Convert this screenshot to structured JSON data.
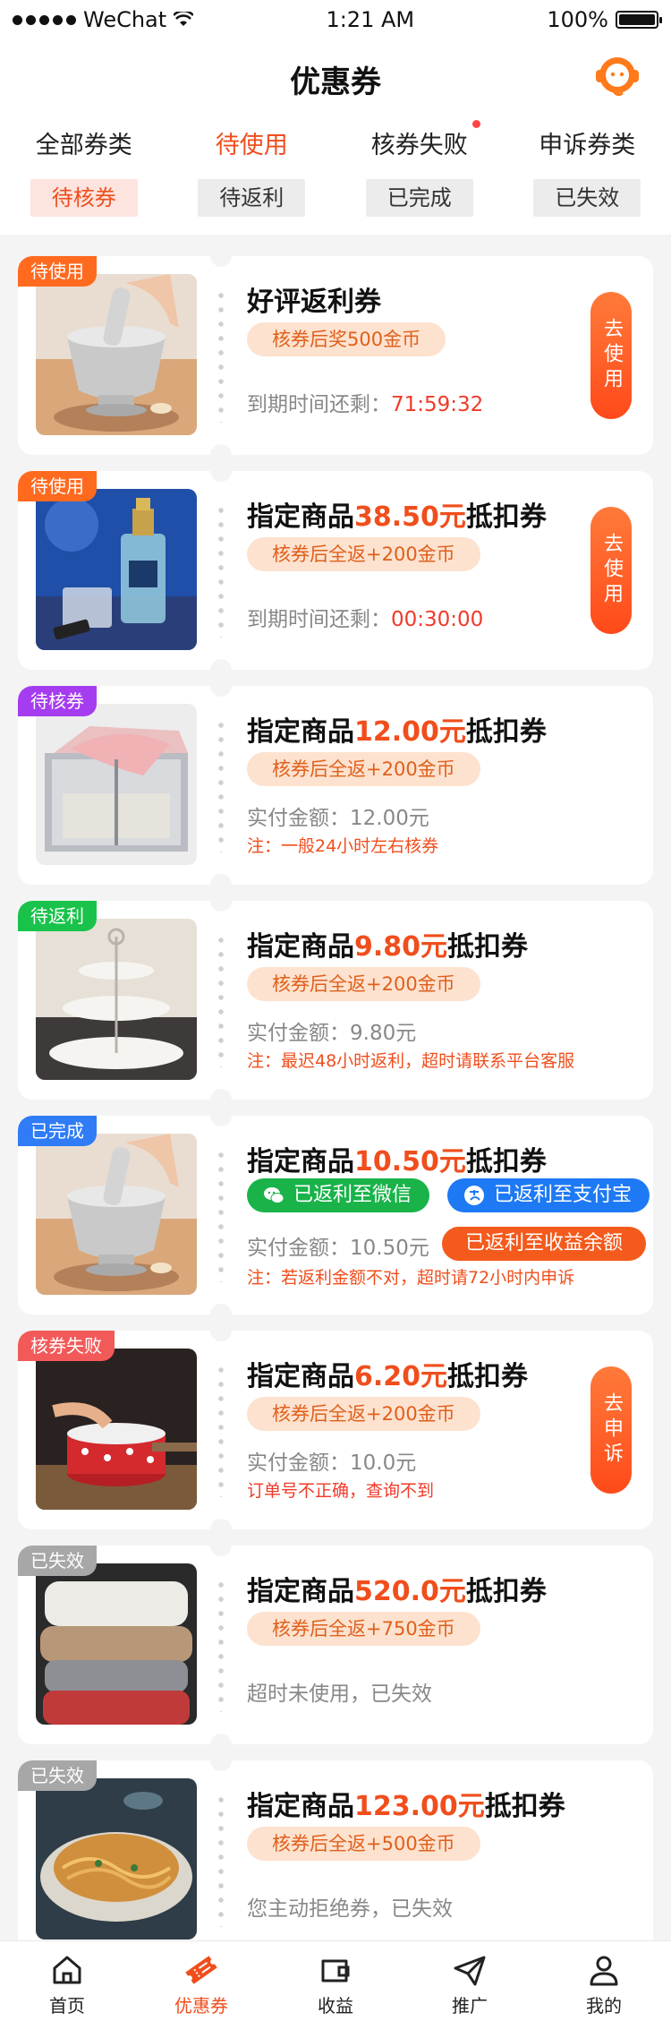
{
  "status_bar": {
    "carrier": "WeChat",
    "time": "1:21 AM",
    "battery": "100%"
  },
  "header": {
    "title": "优惠券",
    "tabs": [
      {
        "label": "全部券类"
      },
      {
        "label": "待使用"
      },
      {
        "label": "核券失败"
      },
      {
        "label": "申诉券类"
      }
    ],
    "subtabs": [
      {
        "label": "待核券"
      },
      {
        "label": "待返利"
      },
      {
        "label": "已完成"
      },
      {
        "label": "已失效"
      }
    ]
  },
  "colors": {
    "accent": "#f04e1c",
    "tag_orange": "#ff6a1f",
    "tag_purple": "#a63cf0",
    "tag_green": "#19c34b",
    "tag_blue": "#2f7cf6",
    "tag_red": "#f25a5a",
    "tag_gray": "#a7a7a7",
    "wechat_green": "#19b34a",
    "alipay_blue": "#1e79f4"
  },
  "coupons": [
    {
      "status": "待使用",
      "title_prefix": "好评返利券",
      "price": "",
      "title_suffix": "",
      "pill": "核券后奖500金币",
      "info_label": "到期时间还剩：",
      "info_value": "71:59:32",
      "action": "去使用",
      "image": "mortar-pestle"
    },
    {
      "status": "待使用",
      "title_prefix": "指定商品",
      "price": "38.50元",
      "title_suffix": "抵扣券",
      "pill": "核券后全返+200金币",
      "info_label": "到期时间还剩：",
      "info_value": "00:30:00",
      "action": "去使用",
      "image": "perfume-bottle"
    },
    {
      "status": "待核券",
      "title_prefix": "指定商品",
      "price": "12.00元",
      "title_suffix": "抵扣券",
      "pill": "核券后全返+200金币",
      "info_label": "实付金额：12.00元",
      "note": "注：一般24小时左右核券",
      "image": "storage-box"
    },
    {
      "status": "待返利",
      "title_prefix": "指定商品",
      "price": "9.80元",
      "title_suffix": "抵扣券",
      "pill": "核券后全返+200金币",
      "info_label": "实付金额：9.80元",
      "note": "注：最迟48小时返利，超时请联系平台客服",
      "image": "tiered-plate"
    },
    {
      "status": "已完成",
      "title_prefix": "指定商品",
      "price": "10.50元",
      "title_suffix": "抵扣券",
      "rebate_wechat": "已返利至微信",
      "rebate_alipay": "已返利至支付宝",
      "rebate_balance": "已返利至收益余额",
      "info_label": "实付金额：10.50元",
      "note": "注：若返利金额不对，超时请72小时内申诉",
      "image": "mortar-pestle"
    },
    {
      "status": "核券失败",
      "title_prefix": "指定商品",
      "price": "6.20元",
      "title_suffix": "抵扣券",
      "pill": "核券后全返+200金币",
      "info_label": "实付金额：10.0元",
      "note": "订单号不正确，查询不到",
      "action": "去申诉",
      "image": "milk-pan"
    },
    {
      "status": "已失效",
      "title_prefix": "指定商品",
      "price": "520.0元",
      "title_suffix": "抵扣券",
      "pill": "核券后全返+750金币",
      "info_label": "超时未使用，已失效",
      "image": "folded-blankets"
    },
    {
      "status": "已失效",
      "title_prefix": "指定商品",
      "price": "123.00元",
      "title_suffix": "抵扣券",
      "pill": "核券后全返+500金币",
      "info_label": "您主动拒绝券，已失效",
      "image": "noodle-bowl"
    }
  ],
  "bottom_nav": [
    {
      "label": "首页",
      "icon": "home-icon"
    },
    {
      "label": "优惠券",
      "icon": "coupon-icon"
    },
    {
      "label": "收益",
      "icon": "wallet-icon"
    },
    {
      "label": "推广",
      "icon": "send-icon"
    },
    {
      "label": "我的",
      "icon": "user-icon"
    }
  ]
}
